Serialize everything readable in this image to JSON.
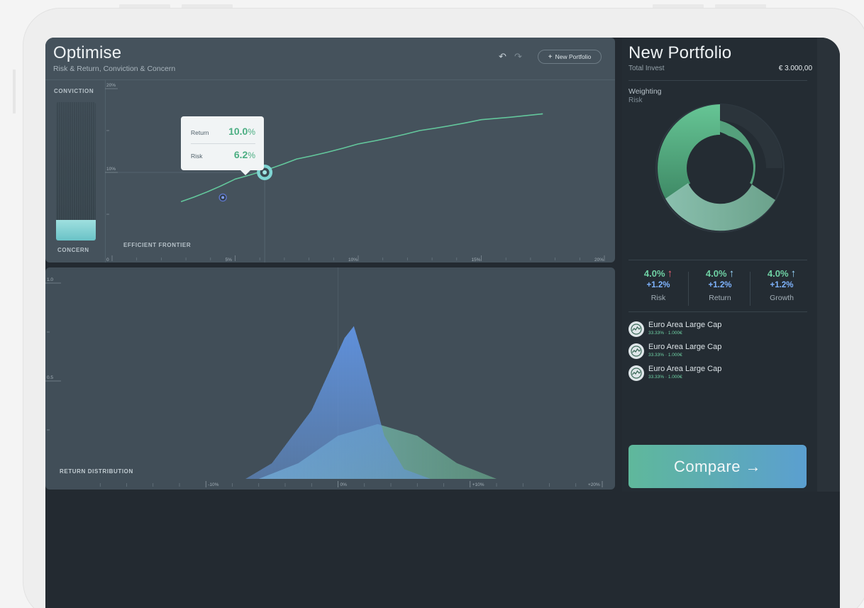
{
  "colors": {
    "accent_green": "#6fd1a4",
    "accent_blue": "#7fb4ff",
    "risk_red": "#ef5f74"
  },
  "toolbar": {
    "undo_icon": "undo-icon",
    "redo_icon": "redo-icon",
    "new_portfolio_label": "New Portfolio"
  },
  "optimise": {
    "title": "Optimise",
    "subtitle": "Risk & Return, Conviction & Concern",
    "conviction_label": "CONVICTION",
    "concern_label": "CONCERN",
    "conviction_level": 0.15,
    "chart_label": "EFFICIENT FRONTIER",
    "tooltip": {
      "return_label": "Return",
      "return_value": "10.0",
      "risk_label": "Risk",
      "risk_value": "6.2",
      "unit": "%"
    }
  },
  "distribution": {
    "label": "RETURN DISTRIBUTION"
  },
  "chart_data": [
    {
      "type": "line",
      "title": "EFFICIENT FRONTIER",
      "x_ticks": [
        "0",
        "5%",
        "10%",
        "15%",
        "20%"
      ],
      "y_ticks": [
        "20%",
        "10%"
      ],
      "xlim": [
        0,
        20
      ],
      "ylim": [
        0,
        20
      ],
      "series": [
        {
          "x": [
            2.8,
            5,
            7.5,
            10,
            12.5,
            15,
            17.5
          ],
          "y": [
            6.5,
            9.2,
            11.6,
            13.4,
            15.0,
            16.3,
            17.0
          ]
        }
      ],
      "highlight_point": {
        "x": 6.2,
        "y": 10.0
      },
      "secondary_point": {
        "x": 4.5,
        "y": 7.0
      }
    },
    {
      "type": "area",
      "title": "RETURN DISTRIBUTION",
      "x_ticks": [
        "-10%",
        "0%",
        "+10%",
        "+20%"
      ],
      "y_ticks": [
        "1.0",
        "0.5"
      ],
      "xlim": [
        -20,
        20
      ],
      "ylim": [
        0,
        1.0
      ],
      "series": [
        {
          "x": [
            -7,
            -5,
            -2,
            0.5,
            1.2,
            2,
            3.5,
            5,
            7
          ],
          "y": [
            0,
            0.08,
            0.35,
            0.72,
            0.78,
            0.6,
            0.22,
            0.05,
            0
          ]
        },
        {
          "x": [
            -6,
            -3,
            0,
            3,
            6,
            9,
            12
          ],
          "y": [
            0,
            0.08,
            0.22,
            0.28,
            0.22,
            0.08,
            0
          ]
        }
      ]
    }
  ],
  "side": {
    "title": "New Portfolio",
    "total_invest_label": "Total Invest",
    "total_invest_value": "€ 3.000,00",
    "weighting_label": "Weighting",
    "risk_label": "Risk",
    "metrics": [
      {
        "value": "4.0%",
        "delta": "+1.2%",
        "label": "Risk",
        "arrow": "↑",
        "arrow_color": "#ef5f74"
      },
      {
        "value": "4.0%",
        "delta": "+1.2%",
        "label": "Return",
        "arrow": "↑",
        "arrow_color": "#9ad8ff"
      },
      {
        "value": "4.0%",
        "delta": "+1.2%",
        "label": "Growth",
        "arrow": "↑",
        "arrow_color": "#9ad8ff"
      }
    ],
    "holdings": [
      {
        "name": "Euro Area Large Cap",
        "detail": "33.33% · 1.000€"
      },
      {
        "name": "Euro Area Large Cap",
        "detail": "33.33% · 1.000€"
      },
      {
        "name": "Euro Area Large Cap",
        "detail": "33.33% · 1.000€"
      }
    ],
    "compare_label": "Compare →"
  }
}
